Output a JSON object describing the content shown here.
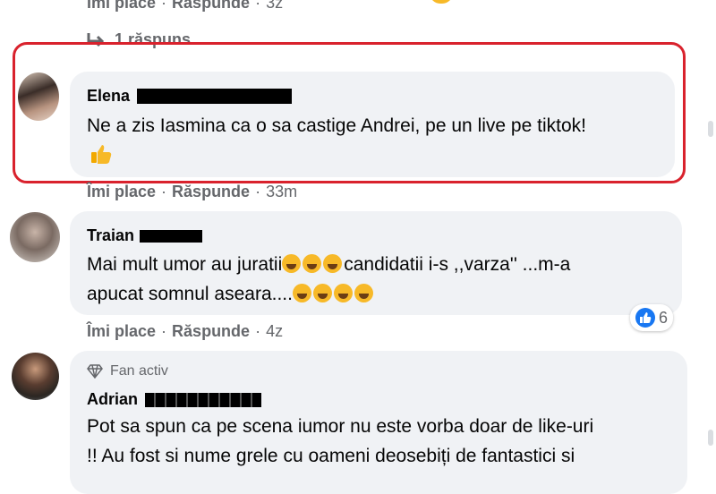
{
  "top": {
    "actions": {
      "like": "Îmi place",
      "reply": "Răspunde",
      "time": "3z"
    },
    "replies_toggle": "1 răspuns"
  },
  "comments": [
    {
      "author": "Elena",
      "text": "Ne a zis Iasmina ca o sa castige Andrei, pe un live pe tiktok!",
      "actions": {
        "like": "Îmi place",
        "reply": "Răspunde",
        "time": "33m"
      }
    },
    {
      "author": "Traian",
      "text_line1": "Mai mult umor au juratii",
      "text_line1_tail": "candidatii i-s ,,varza'' ...m-a",
      "text_line2": "apucat somnul aseara....",
      "actions": {
        "like": "Îmi place",
        "reply": "Răspunde",
        "time": "4z"
      },
      "reaction_count": "6"
    },
    {
      "badge": "Fan activ",
      "author": "Adrian",
      "text_line1": "Pot sa spun ca pe scena iumor nu este vorba doar de like-uri",
      "text_line2": "!! Au fost si nume grele cu oameni deosebiți de fantastici si"
    }
  ],
  "colors": {
    "highlight": "#d9222d",
    "bubble": "#f0f2f5",
    "meta": "#65676b",
    "like_blue": "#1877f2"
  }
}
